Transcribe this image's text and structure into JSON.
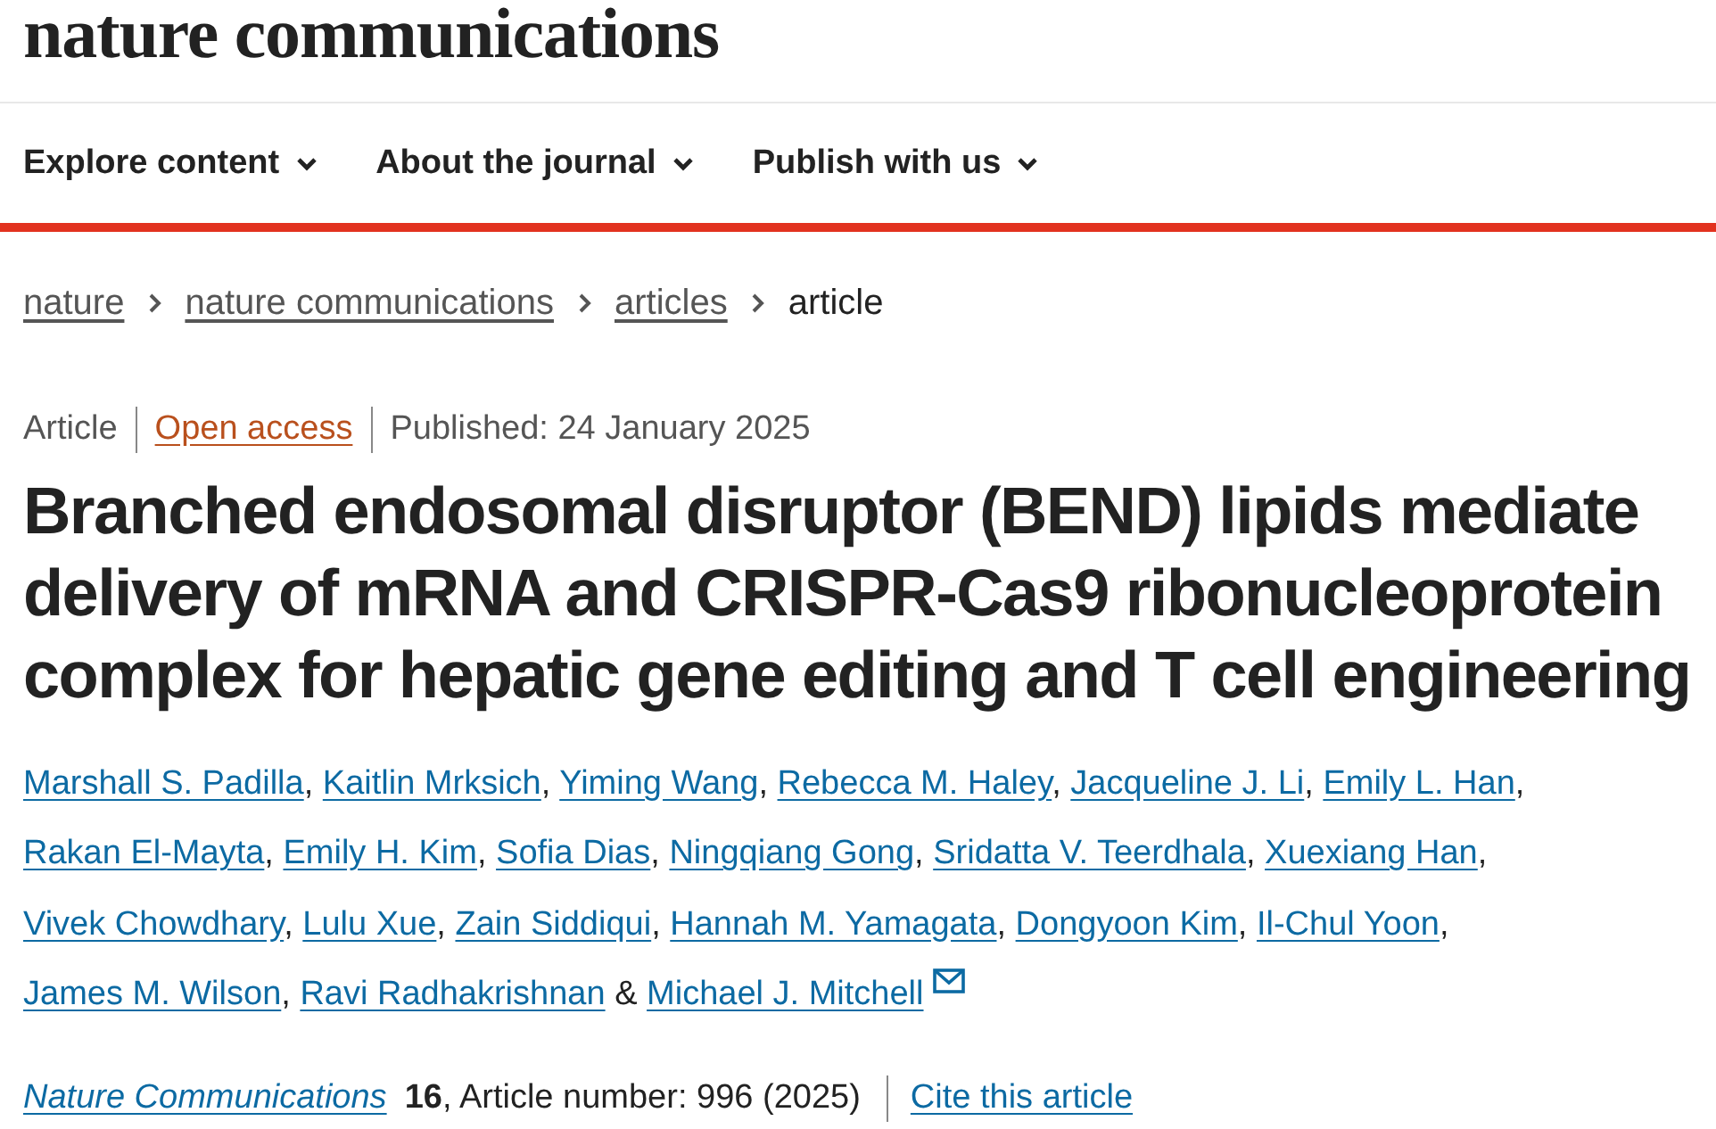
{
  "site": {
    "logo": "nature communications"
  },
  "nav": [
    {
      "label": "Explore content",
      "expanded": false
    },
    {
      "label": "About the journal",
      "expanded": false
    },
    {
      "label": "Publish with us",
      "expanded": false
    }
  ],
  "breadcrumbs": [
    {
      "label": "nature",
      "current": false
    },
    {
      "label": "nature communications",
      "current": false
    },
    {
      "label": "articles",
      "current": false
    },
    {
      "label": "article",
      "current": true
    }
  ],
  "article": {
    "type": "Article",
    "access": "Open access",
    "published": "Published: 24 January 2025",
    "title": "Branched endosomal disruptor (BEND) lipids mediate delivery of mRNA and CRISPR-Cas9 ribonucleoprotein complex for hepatic gene editing and T cell engineering",
    "authors": [
      {
        "name": "Marshall S. Padilla",
        "corresponding": false
      },
      {
        "name": "Kaitlin Mrksich",
        "corresponding": false
      },
      {
        "name": "Yiming Wang",
        "corresponding": false
      },
      {
        "name": "Rebecca M. Haley",
        "corresponding": false
      },
      {
        "name": "Jacqueline J. Li",
        "corresponding": false
      },
      {
        "name": "Emily L. Han",
        "corresponding": false
      },
      {
        "name": "Rakan El-Mayta",
        "corresponding": false
      },
      {
        "name": "Emily H. Kim",
        "corresponding": false
      },
      {
        "name": "Sofia Dias",
        "corresponding": false
      },
      {
        "name": "Ningqiang Gong",
        "corresponding": false
      },
      {
        "name": "Sridatta V. Teerdhala",
        "corresponding": false
      },
      {
        "name": "Xuexiang Han",
        "corresponding": false
      },
      {
        "name": "Vivek Chowdhary",
        "corresponding": false
      },
      {
        "name": "Lulu Xue",
        "corresponding": false
      },
      {
        "name": "Zain Siddiqui",
        "corresponding": false
      },
      {
        "name": "Hannah M. Yamagata",
        "corresponding": false
      },
      {
        "name": "Dongyoon Kim",
        "corresponding": false
      },
      {
        "name": "Il-Chul Yoon",
        "corresponding": false
      },
      {
        "name": "James M. Wilson",
        "corresponding": false
      },
      {
        "name": "Ravi Radhakrishnan",
        "corresponding": false
      },
      {
        "name": "Michael J. Mitchell",
        "corresponding": true
      }
    ],
    "author_separator": ",",
    "final_separator": "&"
  },
  "citation": {
    "journal": "Nature Communications",
    "details": "**16**, Article number: 996 (2025)",
    "cite_link": "Cite this article"
  }
}
